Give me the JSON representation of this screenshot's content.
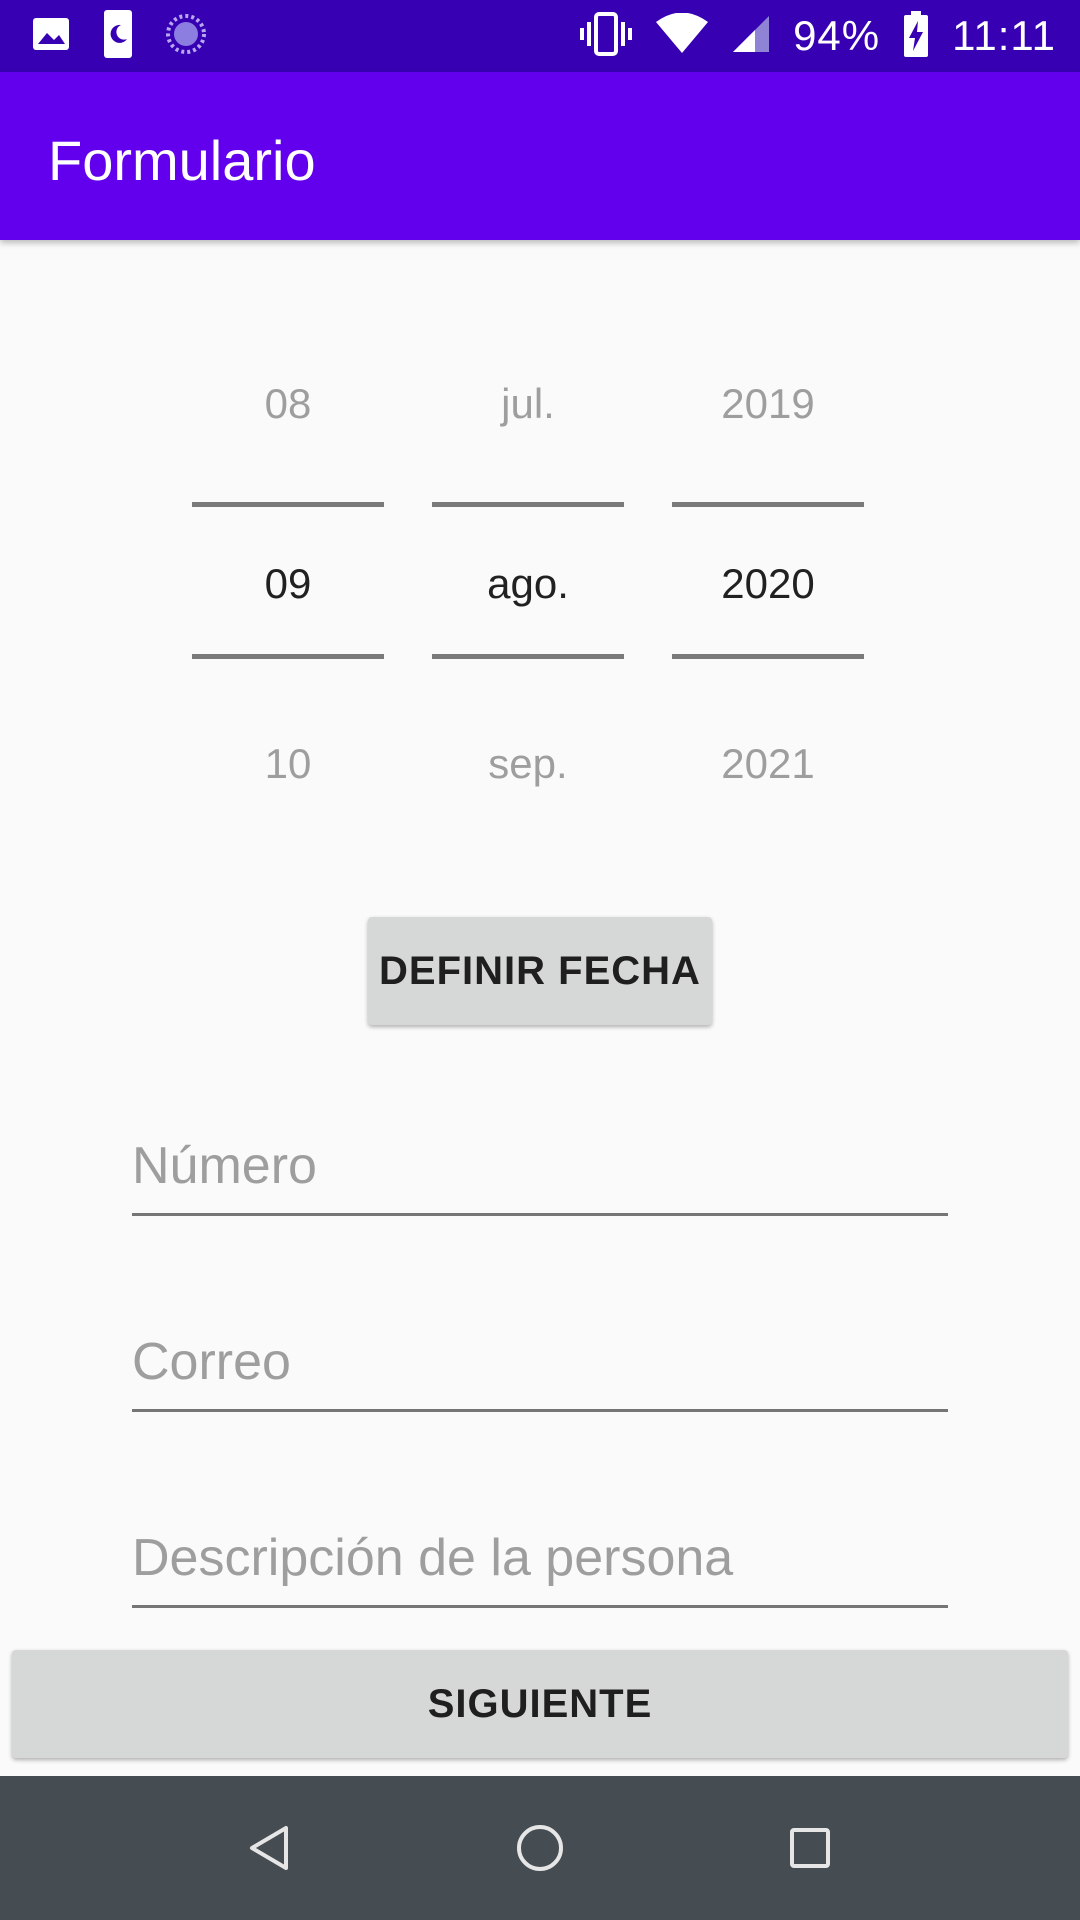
{
  "status_bar": {
    "battery": "94%",
    "time": "11:11",
    "icons": [
      "image-icon",
      "night-mode-icon",
      "sync-icon",
      "vibrate-icon",
      "wifi-icon",
      "signal-icon",
      "battery-charging-icon"
    ]
  },
  "app_bar": {
    "title": "Formulario"
  },
  "date_picker": {
    "day": {
      "prev": "08",
      "selected": "09",
      "next": "10"
    },
    "month": {
      "prev": "jul.",
      "selected": "ago.",
      "next": "sep."
    },
    "year": {
      "prev": "2019",
      "selected": "2020",
      "next": "2021"
    }
  },
  "define_date_button": "DEFINIR FECHA",
  "fields": {
    "numero": {
      "placeholder": "Número",
      "value": ""
    },
    "correo": {
      "placeholder": "Correo",
      "value": ""
    },
    "descripcion": {
      "placeholder": "Descripción de la persona",
      "value": ""
    }
  },
  "next_button": "SIGUIENTE",
  "nav_bar": {
    "icons": [
      "back-icon",
      "home-icon",
      "recent-apps-icon"
    ]
  }
}
